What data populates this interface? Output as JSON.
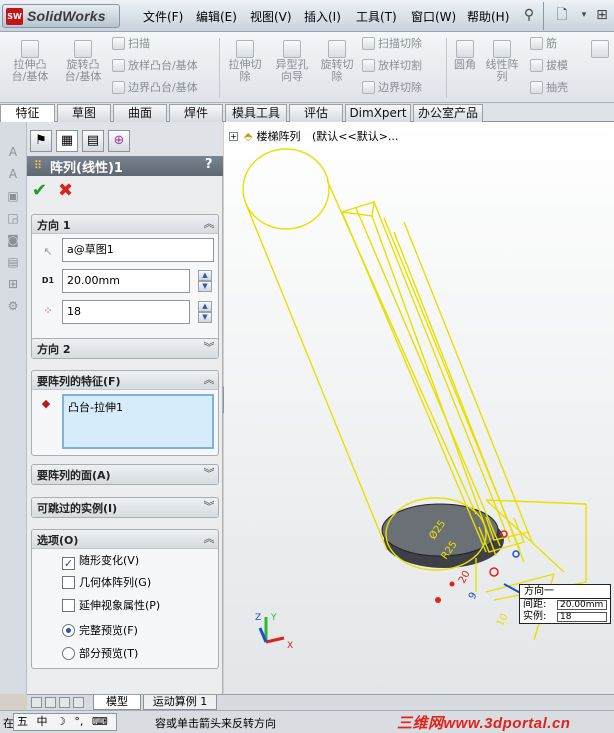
{
  "app": {
    "logo_text": "SolidWorks",
    "logo_mark": "SW"
  },
  "menu": [
    "文件(F)",
    "编辑(E)",
    "视图(V)",
    "插入(I)",
    "工具(T)",
    "窗口(W)",
    "帮助(H)"
  ],
  "command_manager": {
    "big_1": [
      "拉伸凸",
      "台/基体"
    ],
    "big_2": [
      "旋转凸",
      "台/基体"
    ],
    "sweep": "扫描",
    "loft": "放样凸台/基体",
    "boundary": "边界凸台/基体",
    "cut_extrude": [
      "拉伸切",
      "除"
    ],
    "hole_wizard": [
      "异型孔",
      "向导"
    ],
    "cut_revolve": [
      "旋转切",
      "除"
    ],
    "cut_sweep": "扫描切除",
    "cut_loft": "放样切割",
    "cut_boundary": "边界切除",
    "fillet": "圆角",
    "linear_pattern": [
      "线性阵",
      "列"
    ],
    "rib": "筋",
    "draft": "拔模",
    "shell": "抽壳"
  },
  "tabs": [
    "特征",
    "草图",
    "曲面",
    "焊件",
    "模具工具",
    "评估",
    "DimXpert",
    "办公室产品"
  ],
  "active_tab": "特征",
  "pm": {
    "title": "阵列(线性)1",
    "help": "?",
    "ok": "✔",
    "cancel": "✖",
    "dir1": {
      "label": "方向 1",
      "edge_ref": "a@草图1",
      "spacing": "20.00mm",
      "count": "18",
      "spacing_icon_label": "D1"
    },
    "dir2": {
      "label": "方向 2"
    },
    "features": {
      "label": "要阵列的特征(F)",
      "items": [
        "凸台-拉伸1"
      ]
    },
    "faces": {
      "label": "要阵列的面(A)"
    },
    "skip": {
      "label": "可跳过的实例(I)"
    },
    "options": {
      "label": "选项(O)",
      "geometry_change": "随形变化(V)",
      "geometry_pattern": "几何体阵列(G)",
      "propagate_visual": "延伸视象属性(P)",
      "full_preview": "完整预览(F)",
      "partial_preview": "部分预览(T)"
    }
  },
  "graphics": {
    "tree_label": "楼梯阵列",
    "tree_suffix": "(默认<<默认>...",
    "callout": {
      "title": "方向一",
      "spacing_label": "间距:",
      "spacing_value": "20.00mm",
      "count_label": "实例:",
      "count_value": "18"
    },
    "dim_labels": [
      "Ø25",
      "R25",
      "20",
      "9",
      "10"
    ],
    "triad": {
      "x": "X",
      "y": "Y",
      "z": "Z"
    }
  },
  "model_tabs": [
    "模型",
    "运动算例 1"
  ],
  "status": {
    "left": "在",
    "ime_badge": "五",
    "ime_items": [
      "中",
      "☽",
      "°,",
      "⌨"
    ],
    "message": "容或单击箭头来反转方向",
    "watermark": "三维网www.3dportal.cn"
  },
  "colors": {
    "wireframe": "#e8e000",
    "dim_red": "#e0231b",
    "dim_blue": "#1d4fd0",
    "title_bar": "#66707b",
    "selection": "#d6ecfa",
    "accept": "#1f9a2b",
    "reject": "#d6241c"
  }
}
